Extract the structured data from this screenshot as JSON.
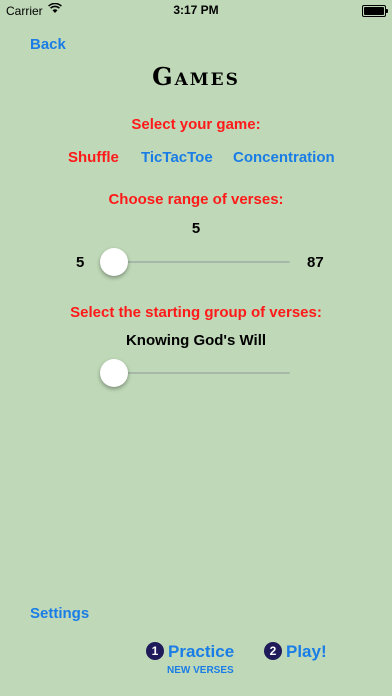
{
  "status_bar": {
    "carrier": "Carrier",
    "time": "3:17 PM",
    "battery_level": 1.0
  },
  "nav": {
    "back_label": "Back"
  },
  "title": "Games",
  "game_select": {
    "prompt": "Select your game:",
    "options": [
      {
        "label": "Shuffle",
        "color": "#ff1a1a",
        "selected": true
      },
      {
        "label": "TicTacToe",
        "color": "#1a7de6",
        "selected": false
      },
      {
        "label": "Concentration",
        "color": "#1a7de6",
        "selected": false
      }
    ]
  },
  "range": {
    "prompt": "Choose range of verses:",
    "value": "5",
    "min_label": "5",
    "max_label": "87",
    "slider_fraction": 0.0
  },
  "group": {
    "prompt": "Select the starting group of verses:",
    "current": "Knowing God's Will",
    "slider_fraction": 0.0
  },
  "footer": {
    "settings_label": "Settings",
    "practice_number": "1",
    "practice_label": "Practice",
    "practice_sub": "NEW VERSES",
    "play_number": "2",
    "play_label": "Play!"
  },
  "colors": {
    "background": "#bfd9b8",
    "accent": "#1a7de6",
    "alert": "#ff1a1a",
    "badge": "#1f1a5a"
  }
}
